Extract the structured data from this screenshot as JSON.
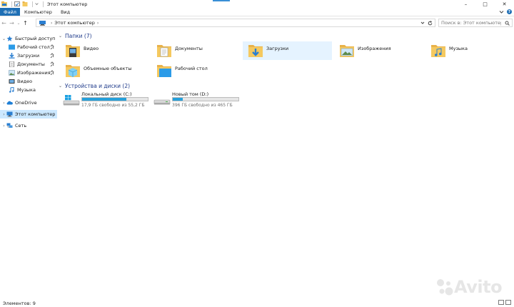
{
  "window": {
    "title": "Этот компьютер"
  },
  "ribbon": {
    "tabs": [
      "Файл",
      "Компьютер",
      "Вид"
    ]
  },
  "address": {
    "path": [
      "Этот компьютер"
    ],
    "search_placeholder": "Поиск в: Этот компьютер"
  },
  "sidebar": {
    "items": [
      {
        "label": "Быстрый доступ",
        "icon": "star-icon",
        "level": "top",
        "pinned": false
      },
      {
        "label": "Рабочий стол",
        "icon": "desktop-icon",
        "level": "sub",
        "pinned": true
      },
      {
        "label": "Загрузки",
        "icon": "downloads-icon",
        "level": "sub",
        "pinned": true
      },
      {
        "label": "Документы",
        "icon": "documents-icon",
        "level": "sub",
        "pinned": true
      },
      {
        "label": "Изображения",
        "icon": "pictures-icon",
        "level": "sub",
        "pinned": true
      },
      {
        "label": "Видео",
        "icon": "video-icon",
        "level": "sub",
        "pinned": false
      },
      {
        "label": "Музыка",
        "icon": "music-icon",
        "level": "sub",
        "pinned": false
      },
      {
        "label": "OneDrive",
        "icon": "onedrive-icon",
        "level": "top",
        "pinned": false
      },
      {
        "label": "Этот компьютер",
        "icon": "computer-icon",
        "level": "top",
        "pinned": false,
        "selected": true
      },
      {
        "label": "Сеть",
        "icon": "network-icon",
        "level": "top",
        "pinned": false
      }
    ]
  },
  "folders_section": {
    "title": "Папки (7)",
    "items": [
      {
        "label": "Видео",
        "icon": "video-folder-icon"
      },
      {
        "label": "Документы",
        "icon": "documents-folder-icon"
      },
      {
        "label": "Загрузки",
        "icon": "downloads-folder-icon",
        "highlighted": true
      },
      {
        "label": "Изображения",
        "icon": "pictures-folder-icon"
      },
      {
        "label": "Музыка",
        "icon": "music-folder-icon"
      },
      {
        "label": "Объемные объекты",
        "icon": "3d-objects-folder-icon"
      },
      {
        "label": "Рабочий стол",
        "icon": "desktop-folder-icon"
      }
    ]
  },
  "drives_section": {
    "title": "Устройства и диски (2)",
    "items": [
      {
        "name": "Локальный диск (C:)",
        "free": "17,9 ГБ свободно из 55,2 ГБ",
        "used_fraction": 0.676,
        "icon": "windows-drive-icon"
      },
      {
        "name": "Новый том (D:)",
        "free": "396 ГБ свободно из 465 ГБ",
        "used_fraction": 0.148,
        "icon": "drive-icon"
      }
    ]
  },
  "status": {
    "text": "Элементов: 9"
  },
  "watermark": {
    "text": "Avito"
  },
  "colors": {
    "accent": "#1f6fb5",
    "selection": "#cce8ff",
    "hover": "#e5f3ff",
    "drive_bar": "#26a0da",
    "folder": "#f5c95f",
    "section_title": "#1e3a8a"
  }
}
